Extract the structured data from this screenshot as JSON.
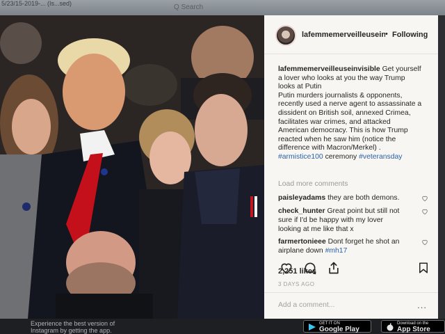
{
  "browser": {
    "tab_title": "5/23/15-2019-... (Is...sed) ",
    "search_placeholder": "Q Search"
  },
  "post": {
    "username": "lafemmemerveilleuseinvisible",
    "follow_state": "Following",
    "caption_lines": [
      "Get yourself",
      "a lover who looks at you the way Trump",
      "looks at Putin",
      "Putin murders journalists & opponents,",
      "recently used a nerve agent to assassinate a",
      "dissident on British soil, annexed Crimea,",
      "facilitates war crimes, and attacked",
      "American democracy. This is how Trump",
      "reacted when he saw him (notice the",
      "difference with Macron/Merkel) ."
    ],
    "hashtag_1": "#armistice100",
    "caption_middle": " ceremony ",
    "hashtag_2": "#veteransday",
    "load_more": "Load more comments",
    "comments": [
      {
        "user": "paisleyadams",
        "text": "they are both demons."
      },
      {
        "user": "check_hunter",
        "text": "Great point but still not",
        "text2": "sure if I'd be happy with my lover",
        "text3": "looking at me like that x"
      },
      {
        "user": "farmertonieee",
        "text": "Dont forget he shot an",
        "text2": "airplane down ",
        "tag": "#mh17"
      }
    ],
    "likes": "2,251 likes",
    "timestamp": "3 DAYS AGO",
    "add_comment_placeholder": "Add a comment...",
    "more_options": "..."
  },
  "banner": {
    "promo_line1": "Experience the best version of",
    "promo_line2": "Instagram by getting the app.",
    "google_small": "GET IT ON",
    "google_big": "Google Play",
    "apple_small": "Download on the",
    "apple_big": "App Store"
  },
  "icons": {
    "heart": "heart-icon",
    "comment": "comment-icon",
    "share": "share-icon",
    "save": "bookmark-icon"
  }
}
